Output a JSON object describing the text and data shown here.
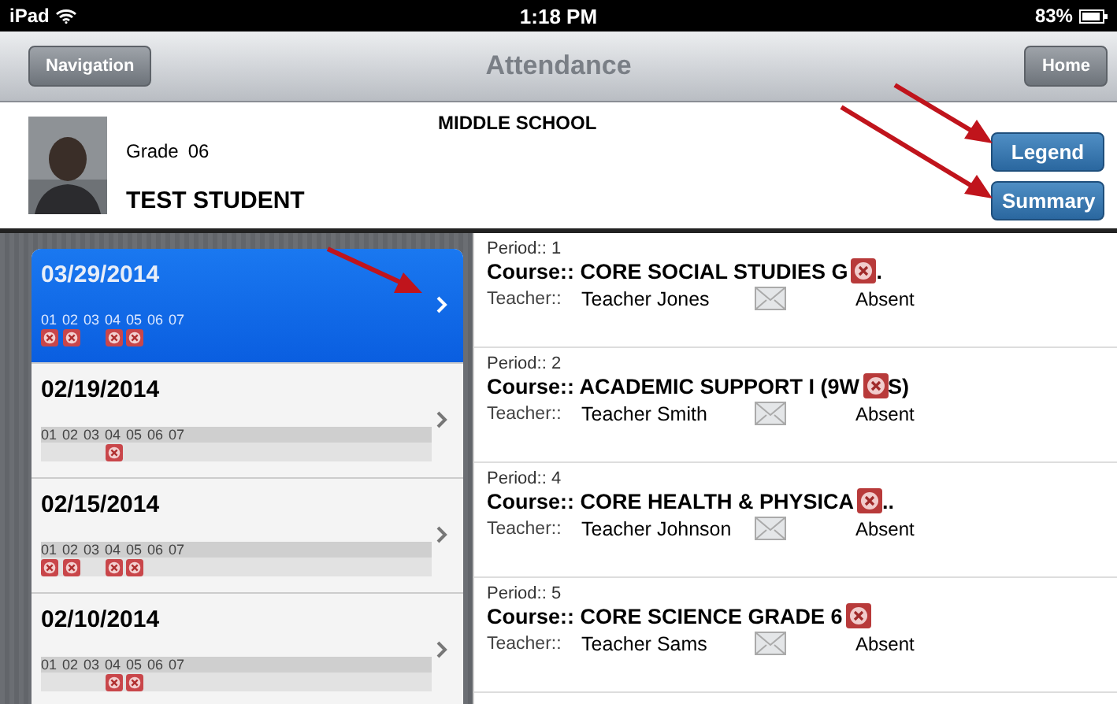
{
  "status_bar": {
    "device": "iPad",
    "time": "1:18 PM",
    "battery": "83%"
  },
  "nav_bar": {
    "back_button": "Navigation",
    "title": "Attendance",
    "home_button": "Home"
  },
  "student": {
    "school": "MIDDLE SCHOOL",
    "grade_label": "Grade",
    "grade": "06",
    "name": "TEST STUDENT"
  },
  "header_buttons": [
    "Legend",
    "Summary"
  ],
  "dates": [
    {
      "date": "03/29/2014",
      "selected": true,
      "periods": [
        {
          "label": "01",
          "absent": true
        },
        {
          "label": "02",
          "absent": true
        },
        {
          "label": "03",
          "absent": false
        },
        {
          "label": "04",
          "absent": true
        },
        {
          "label": "05",
          "absent": true
        },
        {
          "label": "06",
          "absent": false
        },
        {
          "label": "07",
          "absent": false
        }
      ]
    },
    {
      "date": "02/19/2014",
      "selected": false,
      "periods": [
        {
          "label": "01",
          "absent": false
        },
        {
          "label": "02",
          "absent": false
        },
        {
          "label": "03",
          "absent": false
        },
        {
          "label": "04",
          "absent": true
        },
        {
          "label": "05",
          "absent": false
        },
        {
          "label": "06",
          "absent": false
        },
        {
          "label": "07",
          "absent": false
        }
      ]
    },
    {
      "date": "02/15/2014",
      "selected": false,
      "periods": [
        {
          "label": "01",
          "absent": true
        },
        {
          "label": "02",
          "absent": true
        },
        {
          "label": "03",
          "absent": false
        },
        {
          "label": "04",
          "absent": true
        },
        {
          "label": "05",
          "absent": true
        },
        {
          "label": "06",
          "absent": false
        },
        {
          "label": "07",
          "absent": false
        }
      ]
    },
    {
      "date": "02/10/2014",
      "selected": false,
      "periods": [
        {
          "label": "01",
          "absent": false
        },
        {
          "label": "02",
          "absent": false
        },
        {
          "label": "03",
          "absent": false
        },
        {
          "label": "04",
          "absent": true
        },
        {
          "label": "05",
          "absent": true
        },
        {
          "label": "06",
          "absent": false
        },
        {
          "label": "07",
          "absent": false
        }
      ]
    }
  ],
  "classes": [
    {
      "period_label": "Period::",
      "period": "1",
      "course_label": "Course::",
      "course": "CORE SOCIAL STUDIES G",
      "course_tail": ".",
      "absent": true,
      "teacher_label": "Teacher::",
      "teacher": "Teacher Jones",
      "status": "Absent"
    },
    {
      "period_label": "Period::",
      "period": "2",
      "course_label": "Course::",
      "course": "ACADEMIC SUPPORT I (9W",
      "course_tail": "S)",
      "absent": true,
      "teacher_label": "Teacher::",
      "teacher": "Teacher Smith",
      "status": "Absent"
    },
    {
      "period_label": "Period::",
      "period": "4",
      "course_label": "Course::",
      "course": "CORE HEALTH & PHYSICA",
      "course_tail": "..",
      "absent": true,
      "teacher_label": "Teacher::",
      "teacher": "Teacher Johnson",
      "status": "Absent"
    },
    {
      "period_label": "Period::",
      "period": "5",
      "course_label": "Course::",
      "course": "CORE SCIENCE GRADE 6",
      "absent": true,
      "teacher_label": "Teacher::",
      "teacher": "Teacher Sams",
      "status": "Absent"
    }
  ]
}
